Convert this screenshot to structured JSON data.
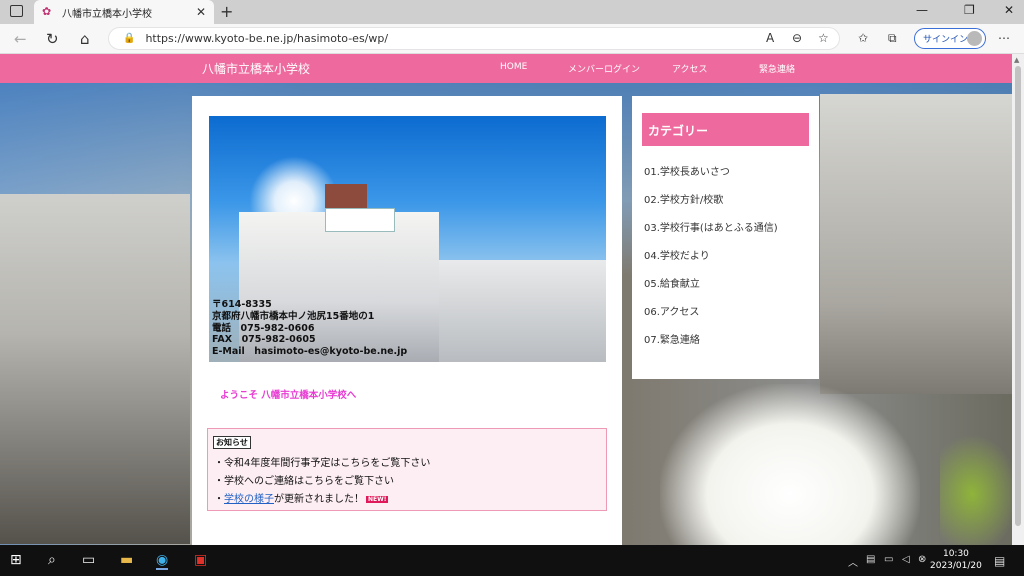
{
  "browser": {
    "tab_title": "八幡市立橋本小学校",
    "url": "https://www.kyoto-be.ne.jp/hasimoto-es/wp/",
    "signin_label": "サインイン"
  },
  "site": {
    "name": "八幡市立橋本小学校",
    "nav": [
      "HOME",
      "メンバーログイン",
      "アクセス",
      "緊急連絡"
    ]
  },
  "hero": {
    "info_lines": [
      "〒614-8335",
      "京都府八幡市橋本中ノ池尻15番地の1",
      "電話　075-982-0606",
      "FAX　075-982-0605",
      "E-Mail　hasimoto-es@kyoto-be.ne.jp"
    ]
  },
  "welcome": "ようこそ 八幡市立橋本小学校へ",
  "notice": {
    "badge": "お知らせ",
    "line1": "・令和4年度年間行事予定はこちらをご覧下さい",
    "line2": "・学校へのご連絡はこちらをご覧下さい",
    "line3_prefix": "・",
    "line3_link": "学校の様子",
    "line3_suffix": "が更新されました！",
    "new_badge": "NEW!"
  },
  "sidebar": {
    "heading": "カテゴリー",
    "items": [
      "01.学校長あいさつ",
      "02.学校方針/校歌",
      "03.学校行事(はあとふる通信)",
      "04.学校だより",
      "05.給食献立",
      "06.アクセス",
      "07.緊急連絡"
    ]
  },
  "taskbar": {
    "time": "10:30",
    "date": "2023/01/20"
  },
  "colors": {
    "accent": "#ee6a9e",
    "welcome": "#e83bd3",
    "notice_bg": "#fdeef3"
  }
}
